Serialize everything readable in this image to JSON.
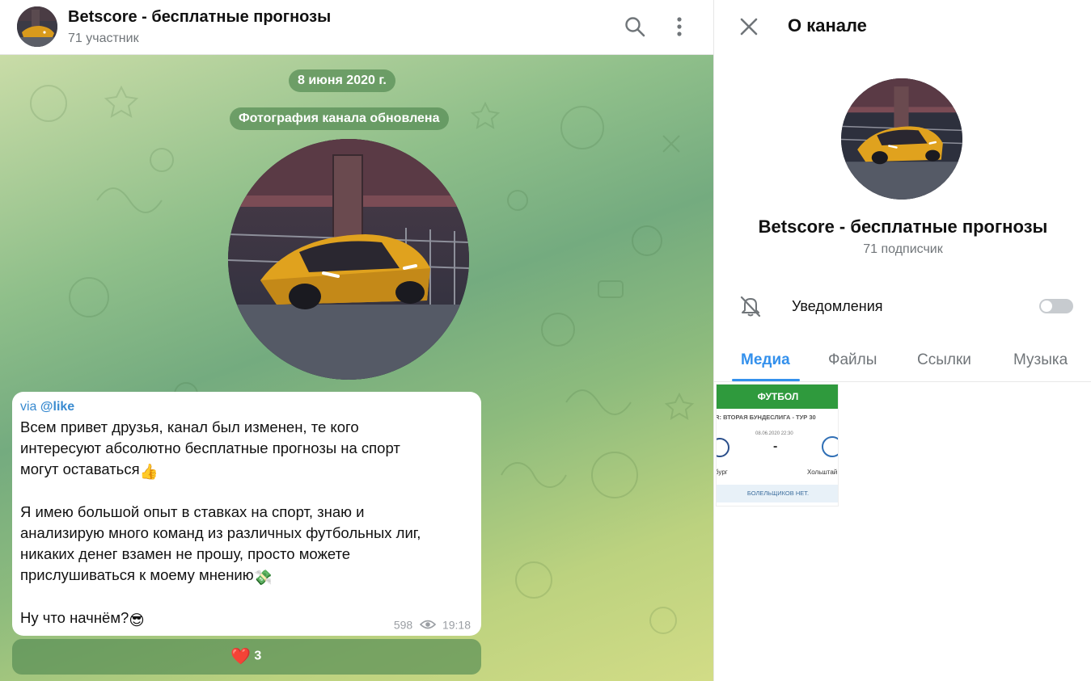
{
  "chat": {
    "title": "Betscore - бесплатные прогнозы",
    "subtitle": "71 участник",
    "date_pill": "8 июня 2020 г.",
    "service_message": "Фотография канала обновлена",
    "message": {
      "via_prefix": "via ",
      "via_user": "@like",
      "lines": [
        "Всем привет друзья, канал был изменен, те кого",
        "интересуют абсолютно бесплатные прогнозы на спорт",
        "могут оставаться",
        "Я имею большой опыт в ставках на спорт, знаю и",
        "анализирую много команд из различных футбольных лиг,",
        "никаких денег взамен не прошу, просто можете",
        "прислушиваться к моему мнению",
        "Ну что начнём?"
      ],
      "emoji": {
        "thumbs_up": "👍",
        "money": "💸",
        "sunglasses": "😎"
      },
      "views": "598",
      "time": "19:18"
    },
    "reaction": {
      "emoji": "❤️",
      "count": "3"
    }
  },
  "panel": {
    "title": "О канале",
    "name": "Betscore - бесплатные прогнозы",
    "subtitle": "71 подписчик",
    "notifications_label": "Уведомления",
    "notifications_enabled": false,
    "tabs": [
      "Медиа",
      "Файлы",
      "Ссылки",
      "Музыка"
    ],
    "active_tab": "Медиа",
    "media_thumb": {
      "header": "ФУТБОЛ",
      "league": "IR: ВТОРАЯ БУНДЕСЛИГА - ТУР 30",
      "datetime": "08.06.2020 22:30",
      "score": "-",
      "team_left": "бург",
      "team_right": "Хольштай",
      "footer": "БОЛЕЛЬЩИКОВ НЕТ."
    }
  },
  "colors": {
    "accent": "#3390ec",
    "link": "#3a8bd0",
    "pill_bg": "#568c54",
    "secondary_text": "#707579"
  },
  "icons": {
    "search": "search-icon",
    "more": "more-vertical-icon",
    "close": "close-icon",
    "bell_off": "bell-off-icon",
    "views": "eye-icon"
  }
}
